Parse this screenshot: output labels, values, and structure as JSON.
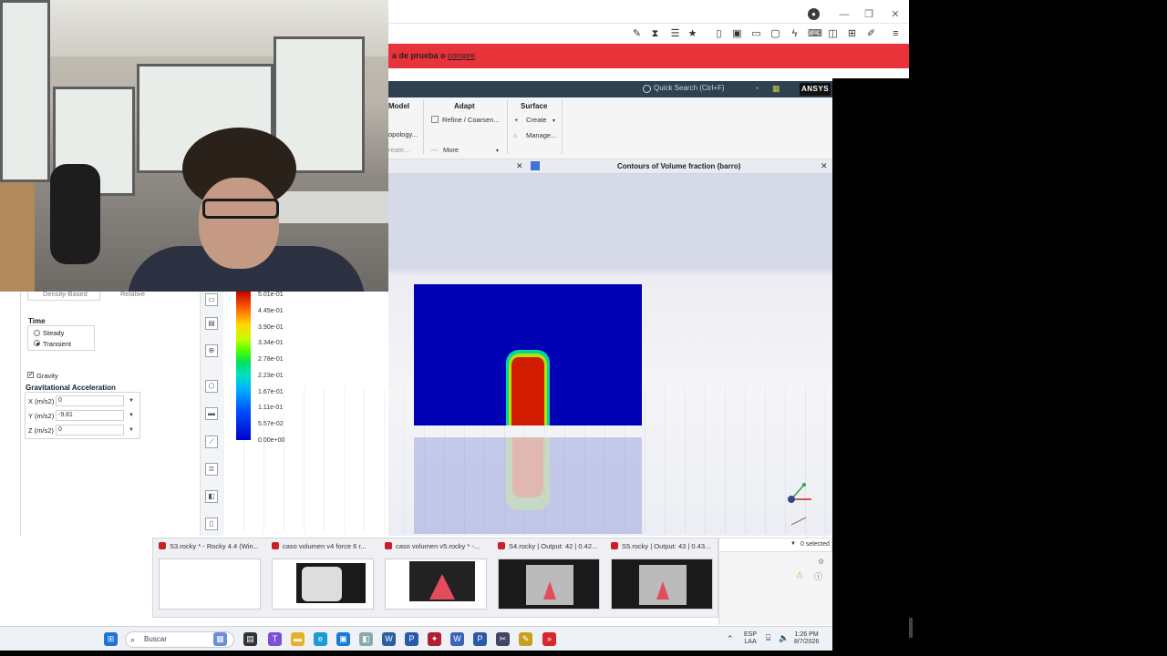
{
  "browser": {
    "banner_text_prefix": "a de prueba o ",
    "banner_link": "compre",
    "banner_suffix": ".",
    "win_min": "—",
    "win_max": "❐",
    "win_close": "✕"
  },
  "ansys": {
    "quick_search": "Quick Search (Ctrl+F)",
    "logo": "ANSYS",
    "ribbon": {
      "model_title": "Model",
      "model_topology": "opology...",
      "model_create": "reate...",
      "adapt_title": "Adapt",
      "adapt_refine": "Refine / Coarsen...",
      "adapt_more": "More",
      "surface_title": "Surface",
      "surface_create": "Create",
      "surface_manage": "Manage..."
    },
    "view_title": "Contours of Volume fraction (barro)"
  },
  "left_panel": {
    "density_based": "Density-Based",
    "relative": "Relative",
    "time_label": "Time",
    "steady": "Steady",
    "transient": "Transient",
    "gravity_label": "Gravity",
    "grav_accel_label": "Gravitational Acceleration",
    "x_label": "X (m/s2)",
    "x_value": "0",
    "y_label": "Y (m/s2)",
    "y_value": "-9.81",
    "z_label": "Z (m/s2)",
    "z_value": "0"
  },
  "colorbar": {
    "labels": [
      "5.01e-01",
      "4.45e-01",
      "3.90e-01",
      "3.34e-01",
      "2.78e-01",
      "2.23e-01",
      "1.67e-01",
      "1.11e-01",
      "5.57e-02",
      "0.00e+00"
    ]
  },
  "previews": [
    {
      "title": "S3.rocky * - Rocky 4.4 (Win..."
    },
    {
      "title": "caso volumen v4 force 6 r..."
    },
    {
      "title": "caso volumen v5.rocky * -..."
    },
    {
      "title": "S4.rocky | Output: 42 | 0.42..."
    },
    {
      "title": "S5.rocky | Output: 43 | 0.43..."
    }
  ],
  "selection": {
    "text": "0 selected"
  },
  "taskbar": {
    "search_placeholder": "Buscar",
    "lang_top": "ESP",
    "lang_bottom": "LAA",
    "time": "1:26 PM",
    "date": "8/7/2026"
  },
  "colors": {
    "banner": "#e8333a",
    "ansys_bar": "#2d4150",
    "contour_bg": "#0000b4"
  }
}
